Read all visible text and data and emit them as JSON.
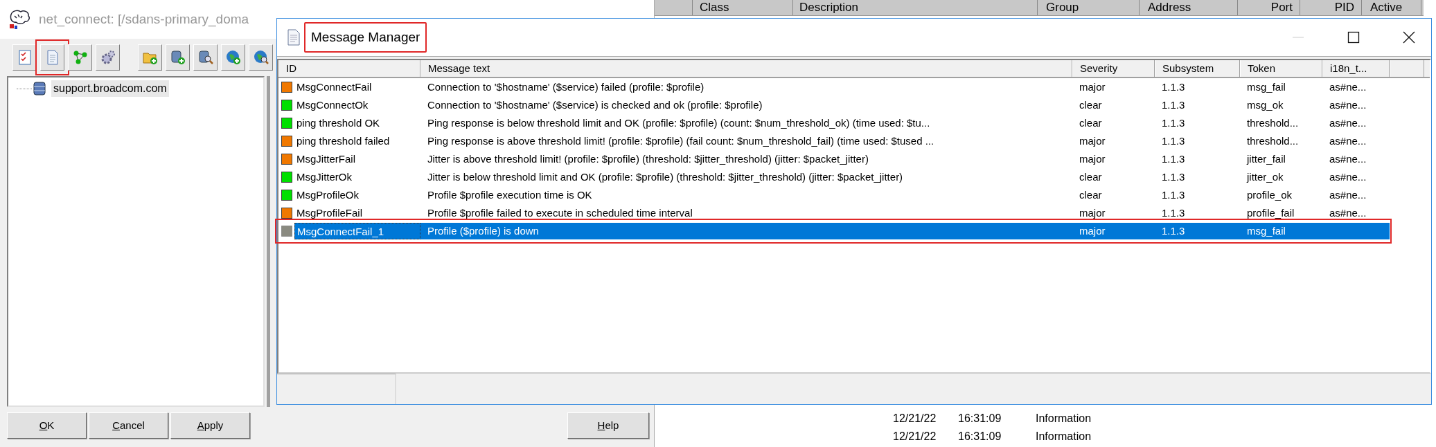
{
  "main_window": {
    "title": "net_connect: [/sdans-primary_doma",
    "toolbar_groups": [
      [
        {
          "kind": "checklist",
          "outlined": false
        },
        {
          "kind": "document",
          "outlined": true
        },
        {
          "kind": "nodes",
          "outlined": false
        },
        {
          "kind": "gear",
          "outlined": false
        }
      ],
      [
        {
          "kind": "folder-add",
          "outlined": false
        },
        {
          "kind": "database-add",
          "outlined": false
        },
        {
          "kind": "database-search",
          "outlined": false
        },
        {
          "kind": "globe-add",
          "outlined": false
        },
        {
          "kind": "globe-search",
          "outlined": false
        }
      ]
    ],
    "tree": [
      {
        "label": "support.broadcom.com",
        "selected": true
      }
    ],
    "buttons": [
      {
        "mnemonic": "O",
        "rest": "K"
      },
      {
        "mnemonic": "C",
        "rest": "ancel"
      },
      {
        "mnemonic": "A",
        "rest": "pply"
      }
    ],
    "help_button": {
      "mnemonic": "H",
      "rest": "elp"
    }
  },
  "background_window": {
    "columns": [
      "Class",
      "Description",
      "Group",
      "Address",
      "Port",
      "PID",
      "Active"
    ],
    "rows": [
      {
        "date": "12/21/22",
        "time": "16:31:09",
        "type": "Information"
      },
      {
        "date": "12/21/22",
        "time": "16:31:09",
        "type": "Information"
      }
    ]
  },
  "message_manager": {
    "title": "Message Manager",
    "title_outlined": true,
    "columns": [
      "ID",
      "Message text",
      "Severity",
      "Subsystem",
      "Token",
      "i18n_t..."
    ],
    "rows": [
      {
        "id": "MsgConnectFail",
        "text": "Connection to '$hostname' ($service) failed  (profile: $profile)",
        "severity": "major",
        "subsystem": "1.1.3",
        "token": "msg_fail",
        "column_6": "as#ne...",
        "color": "#f07800",
        "selected": false,
        "outlined": false
      },
      {
        "id": "MsgConnectOk",
        "text": "Connection to '$hostname' ($service) is checked and ok (profile: $profile)",
        "severity": "clear",
        "subsystem": "1.1.3",
        "token": "msg_ok",
        "column_6": "as#ne...",
        "color": "#00e000",
        "selected": false,
        "outlined": false
      },
      {
        "id": "ping threshold OK",
        "text": "Ping response is below threshold limit and OK (profile: $profile) (count: $num_threshold_ok) (time used: $tu...",
        "severity": "clear",
        "subsystem": "1.1.3",
        "token": "threshold...",
        "column_6": "as#ne...",
        "color": "#00e000",
        "selected": false,
        "outlined": false
      },
      {
        "id": "ping threshold failed",
        "text": "Ping response is above threshold limit! (profile: $profile) (fail count: $num_threshold_fail) (time used: $tused ...",
        "severity": "major",
        "subsystem": "1.1.3",
        "token": "threshold...",
        "column_6": "as#ne...",
        "color": "#f07800",
        "selected": false,
        "outlined": false
      },
      {
        "id": "MsgJitterFail",
        "text": "Jitter is above threshold limit! (profile: $profile) (threshold: $jitter_threshold) (jitter: $packet_jitter)",
        "severity": "major",
        "subsystem": "1.1.3",
        "token": "jitter_fail",
        "column_6": "as#ne...",
        "color": "#f07800",
        "selected": false,
        "outlined": false
      },
      {
        "id": "MsgJitterOk",
        "text": "Jitter is below threshold limit and OK (profile: $profile) (threshold: $jitter_threshold) (jitter: $packet_jitter)",
        "severity": "clear",
        "subsystem": "1.1.3",
        "token": "jitter_ok",
        "column_6": "as#ne...",
        "color": "#00e000",
        "selected": false,
        "outlined": false
      },
      {
        "id": "MsgProfileOk",
        "text": "Profile $profile execution time is OK",
        "severity": "clear",
        "subsystem": "1.1.3",
        "token": "profile_ok",
        "column_6": "as#ne...",
        "color": "#00e000",
        "selected": false,
        "outlined": false
      },
      {
        "id": "MsgProfileFail",
        "text": "Profile $profile failed to execute in scheduled time interval",
        "severity": "major",
        "subsystem": "1.1.3",
        "token": "profile_fail",
        "column_6": "as#ne...",
        "color": "#f07800",
        "selected": false,
        "outlined": false
      },
      {
        "id": "MsgConnectFail_1",
        "text": "Profile ($profile) is down",
        "severity": "major",
        "subsystem": "1.1.3",
        "token": "msg_fail",
        "color": "#8a8a80",
        "selected": true,
        "outlined": true
      }
    ]
  }
}
